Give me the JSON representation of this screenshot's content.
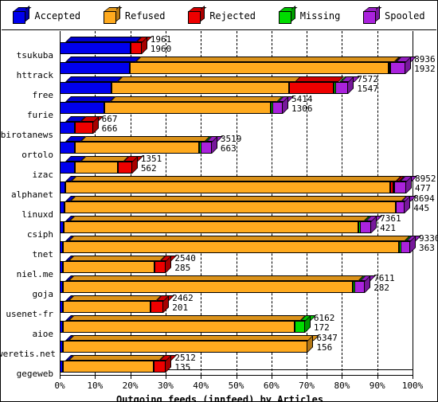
{
  "legend": {
    "items": [
      {
        "label": "Accepted",
        "color": "#0000EE",
        "icon": "cube-icon"
      },
      {
        "label": "Refused",
        "color": "#FFAA1E",
        "icon": "cube-icon"
      },
      {
        "label": "Rejected",
        "color": "#EE0000",
        "icon": "cube-icon"
      },
      {
        "label": "Missing",
        "color": "#00DD00",
        "icon": "cube-icon"
      },
      {
        "label": "Spooled",
        "color": "#AA22DD",
        "icon": "cube-icon"
      }
    ]
  },
  "chart_data": {
    "type": "bar",
    "orientation": "horizontal",
    "stacked": true,
    "style": "3d",
    "title": "Outgoing feeds (innfeed) by Articles",
    "xlabel": "Outgoing feeds (innfeed) by Articles",
    "ylabel": "",
    "xlim": [
      0,
      100
    ],
    "x_unit": "percent",
    "xticks": [
      "0%",
      "10%",
      "20%",
      "30%",
      "40%",
      "50%",
      "60%",
      "70%",
      "80%",
      "90%",
      "100%"
    ],
    "xtick_values": [
      0,
      10,
      20,
      30,
      40,
      50,
      60,
      70,
      80,
      90,
      100
    ],
    "grid": true,
    "legend_position": "top",
    "series": [
      {
        "name": "Accepted",
        "color": "#0000EE"
      },
      {
        "name": "Refused",
        "color": "#FFAA1E"
      },
      {
        "name": "Rejected",
        "color": "#EE0000"
      },
      {
        "name": "Missing",
        "color": "#00DD00"
      },
      {
        "name": "Spooled",
        "color": "#AA22DD"
      }
    ],
    "categories": [
      "tsukuba",
      "httrack",
      "free",
      "furie",
      "birotanews",
      "ortolo",
      "izac",
      "alphanet",
      "linuxd",
      "csiph",
      "tnet",
      "niel.me",
      "goja",
      "usenet-fr",
      "aioe",
      "weretis.net",
      "gegeweb"
    ],
    "rows": [
      {
        "label": "tsukuba",
        "total": 1961,
        "spooled_label": 1960,
        "pct": [
          20.2,
          0.0,
          3.0,
          0.0,
          0.0
        ]
      },
      {
        "label": "httrack",
        "total": 8936,
        "spooled_label": 1932,
        "pct": [
          19.9,
          73.3,
          0.2,
          0.2,
          4.4
        ]
      },
      {
        "label": "free",
        "total": 7572,
        "spooled_label": 1547,
        "pct": [
          14.6,
          50.5,
          12.5,
          0.4,
          3.8
        ]
      },
      {
        "label": "furie",
        "total": 5414,
        "spooled_label": 1306,
        "pct": [
          12.6,
          47.3,
          0.0,
          0.3,
          3.0
        ]
      },
      {
        "label": "birotanews",
        "total": 667,
        "spooled_label": 666,
        "pct": [
          4.4,
          0.0,
          5.0,
          0.0,
          0.0
        ]
      },
      {
        "label": "ortolo",
        "total": 3519,
        "spooled_label": 663,
        "pct": [
          4.4,
          35.2,
          0.0,
          0.3,
          3.2
        ]
      },
      {
        "label": "izac",
        "total": 1351,
        "spooled_label": 562,
        "pct": [
          4.2,
          12.3,
          4.0,
          0.0,
          0.0
        ]
      },
      {
        "label": "alphanet",
        "total": 8952,
        "spooled_label": 477,
        "pct": [
          1.6,
          92.0,
          0.9,
          0.3,
          3.4
        ]
      },
      {
        "label": "linuxd",
        "total": 8694,
        "spooled_label": 445,
        "pct": [
          1.4,
          93.8,
          0.0,
          0.0,
          2.6
        ]
      },
      {
        "label": "csiph",
        "total": 7361,
        "spooled_label": 421,
        "pct": [
          1.2,
          83.5,
          0.0,
          0.4,
          3.2
        ]
      },
      {
        "label": "tnet",
        "total": 9330,
        "spooled_label": 363,
        "pct": [
          1.0,
          95.2,
          0.0,
          0.4,
          2.8
        ]
      },
      {
        "label": "niel.me",
        "total": 2540,
        "spooled_label": 285,
        "pct": [
          0.9,
          26.0,
          3.2,
          0.0,
          0.0
        ]
      },
      {
        "label": "goja",
        "total": 7611,
        "spooled_label": 282,
        "pct": [
          0.9,
          82.2,
          0.0,
          0.4,
          3.0
        ]
      },
      {
        "label": "usenet-fr",
        "total": 2462,
        "spooled_label": 201,
        "pct": [
          0.9,
          24.9,
          3.6,
          0.0,
          0.0
        ]
      },
      {
        "label": "aioe",
        "total": 6162,
        "spooled_label": 172,
        "pct": [
          0.8,
          65.7,
          0.0,
          3.0,
          0.0
        ]
      },
      {
        "label": "weretis.net",
        "total": 6347,
        "spooled_label": 156,
        "pct": [
          0.8,
          69.5,
          0.0,
          0.0,
          0.0
        ]
      },
      {
        "label": "gegeweb",
        "total": 2512,
        "spooled_label": 135,
        "pct": [
          0.9,
          25.8,
          3.4,
          0.0,
          0.0
        ]
      }
    ]
  }
}
